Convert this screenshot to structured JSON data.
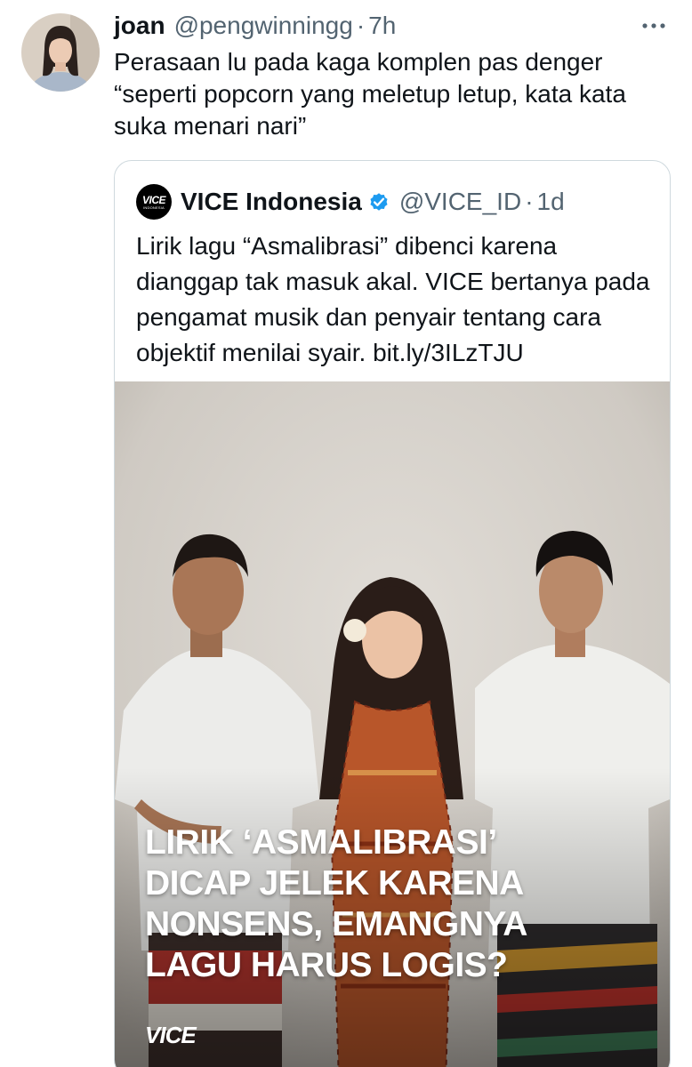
{
  "tweet": {
    "display_name": "joan",
    "handle": "@pengwinningg",
    "separator": "·",
    "time": "7h",
    "text": "Perasaan lu pada kaga komplen pas denger “seperti popcorn yang meletup letup, kata kata suka menari nari”",
    "more_icon": "more-horizontal-icon"
  },
  "quote": {
    "display_name": "VICE Indonesia",
    "verified_icon": "verified-badge-icon",
    "verified_color": "#1d9bf0",
    "handle": "@VICE_ID",
    "separator": "·",
    "time": "1d",
    "text": "Lirik lagu “Asmalibrasi” dibenci karena dianggap tak masuk akal. VICE bertanya pada pengamat musik dan penyair tentang cara objektif menilai syair. bit.ly/3ILzTJU",
    "avatar_logo": {
      "main": "VICE",
      "sub": "INDONESIA"
    },
    "image": {
      "headline_lines": [
        "LIRIK ‘ASMALIBRASI’",
        "DICAP JELEK KARENA",
        "NONSENS, EMANGNYA",
        "LAGU HARUS LOGIS?"
      ],
      "watermark": "VICE"
    }
  },
  "colors": {
    "text_primary": "#0f1419",
    "text_secondary": "#536471",
    "border": "#cfd9de"
  }
}
